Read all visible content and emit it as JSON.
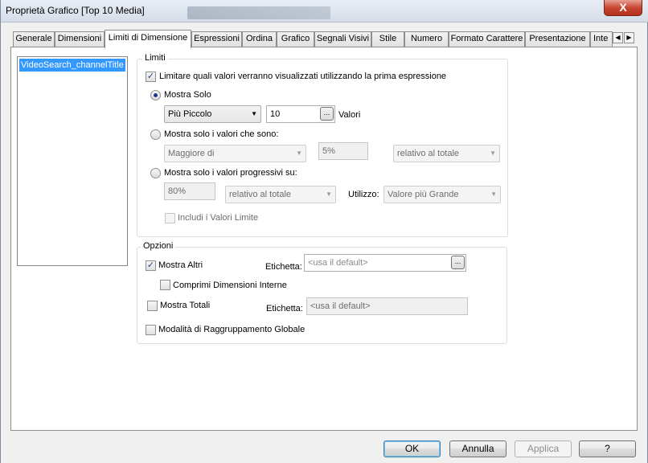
{
  "window": {
    "title": "Proprietà Grafico [Top 10 Media]",
    "close_glyph": "X"
  },
  "tabs": [
    {
      "label": "Generale"
    },
    {
      "label": "Dimensioni"
    },
    {
      "label": "Limiti di Dimensione",
      "active": true
    },
    {
      "label": "Espressioni"
    },
    {
      "label": "Ordina"
    },
    {
      "label": "Grafico"
    },
    {
      "label": "Segnali Visivi"
    },
    {
      "label": "Stile"
    },
    {
      "label": "Numero"
    },
    {
      "label": "Formato Carattere"
    },
    {
      "label": "Presentazione"
    },
    {
      "label": "Inte"
    }
  ],
  "dimensions_list": {
    "items": [
      "VideoSearch_channelTitle"
    ],
    "selected_index": 0
  },
  "limits": {
    "group_title": "Limiti",
    "enable_label": "Limitare quali valori verranno visualizzati utilizzando la prima espressione",
    "enable_checked": true,
    "show_only": {
      "label": "Mostra Solo",
      "selected": true,
      "mode_value": "Più Piccolo",
      "count_value": "10",
      "unit_label": "Valori",
      "browse_glyph": "..."
    },
    "show_values_that_are": {
      "label": "Mostra solo i valori che sono:",
      "selected": false,
      "operator_value": "Maggiore di",
      "percent_value": "5%",
      "relative_value": "relativo al totale"
    },
    "show_accumulated": {
      "label": "Mostra solo i valori progressivi su:",
      "selected": false,
      "percent_value": "80%",
      "relative_value": "relativo al totale",
      "use_label": "Utilizzo:",
      "use_value": "Valore più Grande"
    },
    "include_limits_label": "Includi i Valori Limite",
    "include_limits_checked": false
  },
  "options": {
    "group_title": "Opzioni",
    "show_others_label": "Mostra Altri",
    "show_others_checked": true,
    "others_label_caption": "Etichetta:",
    "others_label_placeholder": "<usa il default>",
    "collapse_label": "Comprimi Dimensioni Interne",
    "collapse_checked": false,
    "show_totals_label": "Mostra Totali",
    "show_totals_checked": false,
    "totals_label_caption": "Etichetta:",
    "totals_label_placeholder": "<usa il default>",
    "global_grouping_label": "Modalità di Raggruppamento Globale",
    "global_grouping_checked": false
  },
  "footer": {
    "ok_label": "OK",
    "cancel_label": "Annulla",
    "apply_label": "Applica",
    "help_label": "?"
  },
  "colors": {
    "selection": "#3399ff",
    "close_button": "#c74734"
  }
}
